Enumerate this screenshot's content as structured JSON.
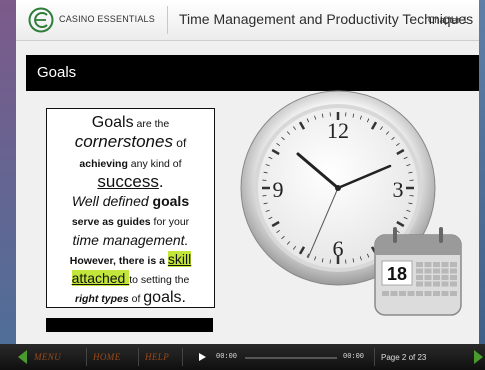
{
  "header": {
    "brand": "CASINO ESSENTIALS",
    "course_title": "Time Management and Productivity Techniques",
    "chapter": "Chapter 1"
  },
  "slide": {
    "title": "Goals",
    "text": {
      "l1a": "Goals",
      "l1b": " are the",
      "l2a": "cornerstones",
      "l2b": " of",
      "l3a": "achieving",
      "l3b": " any kind of",
      "l4": "success",
      "l4p": ".",
      "l5a": "Well defined ",
      "l5b": "goals",
      "l6a": "serve as guides",
      "l6b": " for your",
      "l7": "time management.",
      "l8a": "However, there is a ",
      "l8b": "skill",
      "l9a": "attached ",
      "l9b": "to setting the",
      "l10a": "right types",
      "l10b": " of ",
      "l10c": "goals."
    },
    "calendar_day": "18",
    "clock_numbers": [
      "12",
      "3",
      "6",
      "9"
    ]
  },
  "player": {
    "menu": "MENU",
    "home": "HOME",
    "help": "HELP",
    "time_current": "00:00",
    "time_total": "00:00",
    "page_info": "Page 2 of 23"
  },
  "colors": {
    "highlight": "#c3e63b",
    "nav_text": "#9c4a18",
    "nav_arrow": "#4a9b2d",
    "logo_green": "#2f7d3a"
  },
  "icons": [
    "logo-icon",
    "clock-icon",
    "calendar-icon",
    "play-icon",
    "prev-arrow-icon",
    "next-arrow-icon"
  ]
}
